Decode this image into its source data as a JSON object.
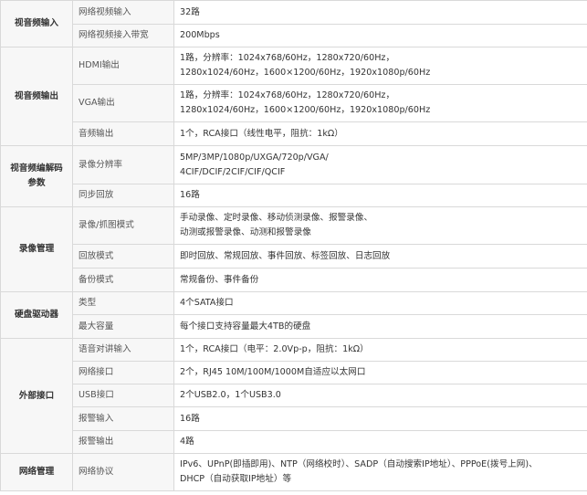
{
  "rows": [
    {
      "category": "视音频输入",
      "name": "网络视频输入",
      "value": [
        "32路"
      ]
    },
    {
      "name": "网络视频接入带宽",
      "value": [
        "200Mbps"
      ]
    },
    {
      "category": "视音频输出",
      "name": "HDMI输出",
      "value": [
        "1路，分辨率：1024x768/60Hz，1280x720/60Hz，",
        "1280x1024/60Hz，1600×1200/60Hz，1920x1080p/60Hz"
      ]
    },
    {
      "name": "VGA输出",
      "value": [
        "1路，分辨率：1024x768/60Hz，1280x720/60Hz，",
        "1280x1024/60Hz，1600×1200/60Hz，1920x1080p/60Hz"
      ]
    },
    {
      "name": "音频输出",
      "value": [
        "1个，RCA接口（线性电平，阻抗：1kΩ）"
      ]
    },
    {
      "category": "视音频编解码参数",
      "name": "录像分辨率",
      "value": [
        "5MP/3MP/1080p/UXGA/720p/VGA/",
        "4CIF/DCIF/2CIF/CIF/QCIF"
      ]
    },
    {
      "name": "同步回放",
      "value": [
        "16路"
      ]
    },
    {
      "category": "录像管理",
      "name": "录像/抓图模式",
      "value": [
        "手动录像、定时录像、移动侦测录像、报警录像、",
        "动测或报警录像、动测和报警录像"
      ]
    },
    {
      "name": "回放模式",
      "value": [
        "即时回放、常规回放、事件回放、标签回放、日志回放"
      ]
    },
    {
      "name": "备份模式",
      "value": [
        "常规备份、事件备份"
      ]
    },
    {
      "category": "硬盘驱动器",
      "name": "类型",
      "value": [
        "4个SATA接口"
      ]
    },
    {
      "name": "最大容量",
      "value": [
        "每个接口支持容量最大4TB的硬盘"
      ]
    },
    {
      "category": "外部接口",
      "name": "语音对讲输入",
      "value": [
        "1个，RCA接口（电平：2.0Vp-p，阻抗：1kΩ）"
      ]
    },
    {
      "name": "网络接口",
      "value": [
        "2个，RJ45 10M/100M/1000M自适应以太网口"
      ]
    },
    {
      "name": "USB接口",
      "value": [
        "2个USB2.0，1个USB3.0"
      ]
    },
    {
      "name": "报警输入",
      "value": [
        "16路"
      ]
    },
    {
      "name": "报警输出",
      "value": [
        "4路"
      ]
    },
    {
      "category": "网络管理",
      "name": "网络协议",
      "value": [
        "IPv6、UPnP(即插即用)、NTP（网络校时）、SADP（自动搜索IP地址）、PPPoE(拨号上网)、",
        "DHCP（自动获取IP地址）等"
      ]
    }
  ]
}
